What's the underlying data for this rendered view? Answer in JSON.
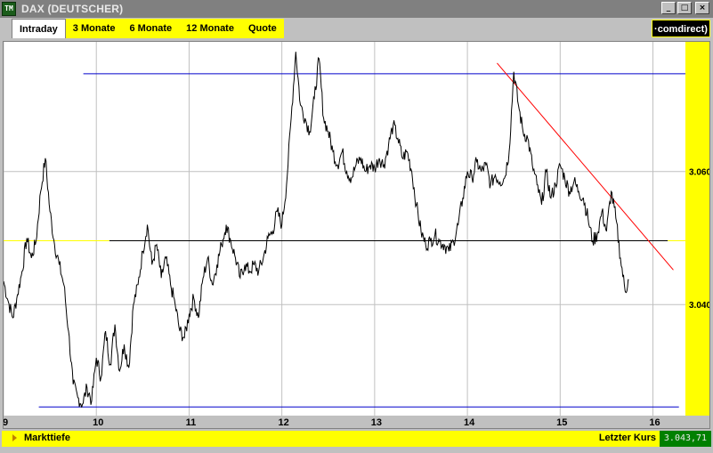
{
  "window": {
    "icon_text": "TM",
    "title": "DAX (DEUTSCHER)",
    "buttons": {
      "minimize": "_",
      "maximize": "□",
      "close": "×"
    }
  },
  "tabs": [
    {
      "label": "Intraday",
      "active": true
    },
    {
      "label": "3 Monate",
      "active": false
    },
    {
      "label": "6 Monate",
      "active": false
    },
    {
      "label": "12 Monate",
      "active": false
    },
    {
      "label": "Quote",
      "active": false
    }
  ],
  "brand": "·comdirect)",
  "chart_data": {
    "type": "line",
    "x_ticks": [
      "9",
      "10",
      "11",
      "12",
      "13",
      "14",
      "15",
      "16"
    ],
    "y_ticks": [
      "3.060",
      "3.040"
    ],
    "y_tick_values": [
      3060,
      3040
    ],
    "xlim": [
      9,
      16.35
    ],
    "ylim": [
      3023.3,
      3079.5
    ],
    "grid": true,
    "series": [
      {
        "values": [
          [
            9.0,
            3043.5
          ],
          [
            9.05,
            3040.5
          ],
          [
            9.1,
            3038.0
          ],
          [
            9.15,
            3041.5
          ],
          [
            9.2,
            3045.0
          ],
          [
            9.25,
            3050.0
          ],
          [
            9.3,
            3047.0
          ],
          [
            9.35,
            3049.5
          ],
          [
            9.4,
            3057.0
          ],
          [
            9.45,
            3062.0
          ],
          [
            9.5,
            3054.0
          ],
          [
            9.55,
            3049.0
          ],
          [
            9.6,
            3046.0
          ],
          [
            9.65,
            3043.0
          ],
          [
            9.7,
            3036.0
          ],
          [
            9.75,
            3028.0
          ],
          [
            9.8,
            3026.0
          ],
          [
            9.85,
            3025.0
          ],
          [
            9.9,
            3027.5
          ],
          [
            9.95,
            3025.5
          ],
          [
            10.0,
            3032.0
          ],
          [
            10.05,
            3029.0
          ],
          [
            10.1,
            3036.0
          ],
          [
            10.15,
            3031.0
          ],
          [
            10.2,
            3037.0
          ],
          [
            10.25,
            3030.0
          ],
          [
            10.3,
            3034.0
          ],
          [
            10.35,
            3030.5
          ],
          [
            10.4,
            3040.0
          ],
          [
            10.45,
            3043.0
          ],
          [
            10.5,
            3048.0
          ],
          [
            10.55,
            3052.0
          ],
          [
            10.6,
            3046.0
          ],
          [
            10.65,
            3049.0
          ],
          [
            10.7,
            3044.0
          ],
          [
            10.75,
            3047.0
          ],
          [
            10.8,
            3043.0
          ],
          [
            10.85,
            3040.0
          ],
          [
            10.9,
            3036.0
          ],
          [
            10.95,
            3035.0
          ],
          [
            11.0,
            3038.5
          ],
          [
            11.05,
            3041.0
          ],
          [
            11.1,
            3038.0
          ],
          [
            11.15,
            3044.0
          ],
          [
            11.2,
            3047.0
          ],
          [
            11.25,
            3043.0
          ],
          [
            11.3,
            3046.0
          ],
          [
            11.35,
            3049.0
          ],
          [
            11.4,
            3052.0
          ],
          [
            11.45,
            3049.5
          ],
          [
            11.5,
            3047.0
          ],
          [
            11.55,
            3044.0
          ],
          [
            11.6,
            3046.0
          ],
          [
            11.65,
            3045.0
          ],
          [
            11.7,
            3046.0
          ],
          [
            11.75,
            3045.0
          ],
          [
            11.8,
            3047.0
          ],
          [
            11.85,
            3050.0
          ],
          [
            11.9,
            3051.0
          ],
          [
            11.95,
            3054.0
          ],
          [
            12.0,
            3052.0
          ],
          [
            12.05,
            3058.0
          ],
          [
            12.1,
            3068.0
          ],
          [
            12.15,
            3078.0
          ],
          [
            12.2,
            3070.0
          ],
          [
            12.25,
            3068.0
          ],
          [
            12.3,
            3066.0
          ],
          [
            12.35,
            3071.0
          ],
          [
            12.4,
            3077.0
          ],
          [
            12.45,
            3068.0
          ],
          [
            12.5,
            3066.0
          ],
          [
            12.55,
            3063.0
          ],
          [
            12.6,
            3061.0
          ],
          [
            12.65,
            3063.0
          ],
          [
            12.7,
            3060.0
          ],
          [
            12.75,
            3059.0
          ],
          [
            12.8,
            3061.0
          ],
          [
            12.85,
            3062.0
          ],
          [
            12.9,
            3060.0
          ],
          [
            12.95,
            3061.0
          ],
          [
            13.0,
            3060.5
          ],
          [
            13.05,
            3062.0
          ],
          [
            13.1,
            3061.0
          ],
          [
            13.15,
            3064.0
          ],
          [
            13.2,
            3067.0
          ],
          [
            13.25,
            3065.0
          ],
          [
            13.3,
            3062.0
          ],
          [
            13.35,
            3063.0
          ],
          [
            13.4,
            3060.0
          ],
          [
            13.45,
            3055.0
          ],
          [
            13.5,
            3051.0
          ],
          [
            13.55,
            3049.0
          ],
          [
            13.6,
            3049.5
          ],
          [
            13.65,
            3050.5
          ],
          [
            13.7,
            3049.5
          ],
          [
            13.75,
            3049.0
          ],
          [
            13.8,
            3048.0
          ],
          [
            13.85,
            3049.5
          ],
          [
            13.9,
            3052.0
          ],
          [
            13.95,
            3056.0
          ],
          [
            14.0,
            3060.0
          ],
          [
            14.05,
            3059.0
          ],
          [
            14.1,
            3061.5
          ],
          [
            14.15,
            3060.0
          ],
          [
            14.2,
            3061.0
          ],
          [
            14.25,
            3058.0
          ],
          [
            14.3,
            3059.5
          ],
          [
            14.35,
            3058.5
          ],
          [
            14.4,
            3059.0
          ],
          [
            14.45,
            3063.0
          ],
          [
            14.5,
            3075.0
          ],
          [
            14.55,
            3070.0
          ],
          [
            14.6,
            3066.0
          ],
          [
            14.65,
            3065.0
          ],
          [
            14.7,
            3061.0
          ],
          [
            14.75,
            3058.0
          ],
          [
            14.8,
            3055.0
          ],
          [
            14.85,
            3060.0
          ],
          [
            14.9,
            3056.0
          ],
          [
            14.95,
            3058.0
          ],
          [
            15.0,
            3061.0
          ],
          [
            15.05,
            3059.0
          ],
          [
            15.1,
            3057.0
          ],
          [
            15.15,
            3058.5
          ],
          [
            15.2,
            3057.0
          ],
          [
            15.25,
            3056.0
          ],
          [
            15.3,
            3053.0
          ],
          [
            15.35,
            3049.5
          ],
          [
            15.4,
            3050.5
          ],
          [
            15.45,
            3054.0
          ],
          [
            15.5,
            3051.0
          ],
          [
            15.55,
            3057.0
          ],
          [
            15.6,
            3053.0
          ],
          [
            15.65,
            3047.0
          ],
          [
            15.7,
            3042.0
          ],
          [
            15.74,
            3043.7
          ]
        ]
      }
    ],
    "annotations": [
      {
        "type": "hline",
        "y": 3074.7,
        "x1": 9.86,
        "x2": 16.35,
        "color": "#0000cc"
      },
      {
        "type": "hline",
        "y": 3024.6,
        "x1": 9.38,
        "x2": 16.28,
        "color": "#0000cc"
      },
      {
        "type": "hline",
        "y": 3049.6,
        "x1": 10.14,
        "x2": 16.16,
        "color": "#000000"
      },
      {
        "type": "hline",
        "y": 3049.6,
        "x1": 9.0,
        "x2": 10.14,
        "color": "#ffff00"
      },
      {
        "type": "hline",
        "y": 3049.6,
        "x1": 16.16,
        "x2": 16.35,
        "color": "#ffff00"
      },
      {
        "type": "trendline",
        "x1": 14.32,
        "y1": 3076.3,
        "x2": 16.22,
        "y2": 3045.2,
        "color": "#ff0000"
      }
    ]
  },
  "status": {
    "left_label": "Markttiefe",
    "right_label": "Letzter Kurs",
    "last_price": "3.043,71"
  }
}
